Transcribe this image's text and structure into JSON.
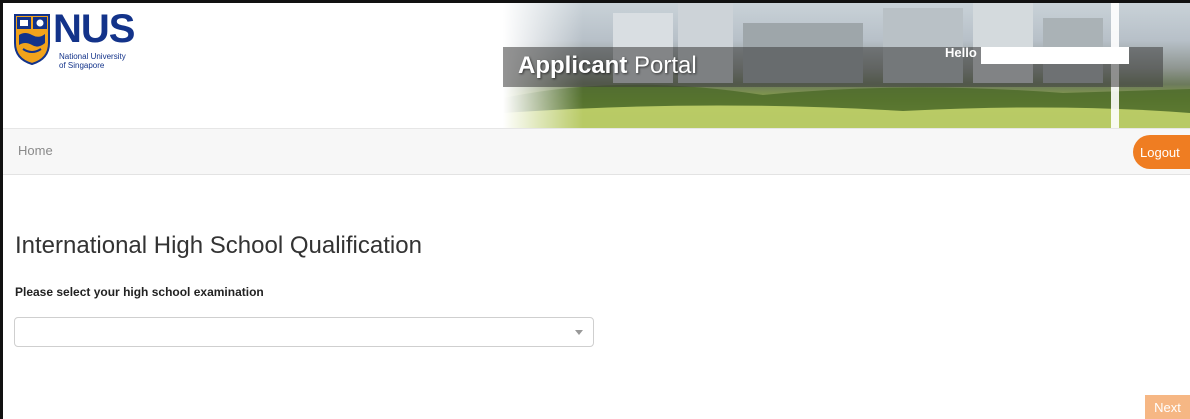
{
  "header": {
    "logo": {
      "wordmark": "NUS",
      "subtitle_line1": "National University",
      "subtitle_line2": "of Singapore"
    },
    "portal_title_bold": "Applicant",
    "portal_title_rest": " Portal",
    "greeting": "Hello"
  },
  "navbar": {
    "home_label": "Home",
    "logout_label": "Logout"
  },
  "main": {
    "page_title": "International High School Qualification",
    "exam_label": "Please select your high school examination",
    "exam_select_value": "",
    "next_label": "Next"
  },
  "colors": {
    "brand_blue": "#13338a",
    "accent_orange": "#ef7d22",
    "next_disabled": "#f6b784"
  },
  "icons": {
    "crest": "nus-crest-icon",
    "dropdown": "chevron-down-icon"
  }
}
